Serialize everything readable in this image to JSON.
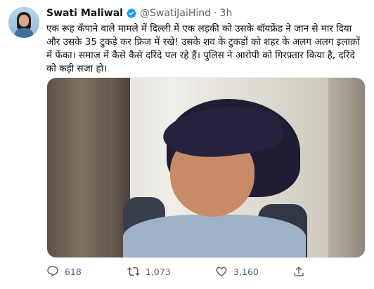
{
  "tweet": {
    "author_name": "Swati Maliwal",
    "handle": "@SwatiJaiHind",
    "separator": "·",
    "time": "3h",
    "text": "एक रूह कँपाने वाले मामले में दिल्ली में एक लड़की को उसके बॉयफ्रेंड ने जान से मार दिया और उसके 35 टुकड़े कर फ्रिज में रखे! उसके शव के टुकड़ों को शहर के अलग अलग इलाक़ों में फेंका। समाज में कैसे कैसे दरिंदे पल रहे हैं। पुलिस ने आरोपी को गिरफ़्तार किया है, दरिंदे को कड़ी सजा हो।",
    "replies": "618",
    "retweets": "1,073",
    "likes": "3,160"
  },
  "colors": {
    "verified": "#1d9bf0",
    "muted_text": "#536471",
    "text": "#0f1419"
  },
  "icons": {
    "verified": "verified-badge-icon",
    "reply": "reply-icon",
    "retweet": "retweet-icon",
    "like": "heart-icon"
  }
}
